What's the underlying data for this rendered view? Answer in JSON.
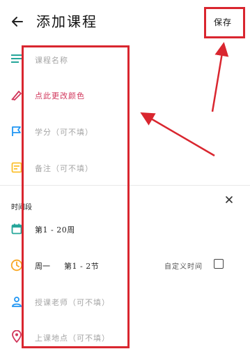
{
  "header": {
    "title": "添加课程",
    "save_label": "保存"
  },
  "form": {
    "course_name_placeholder": "课程名称",
    "color_label": "点此更改颜色",
    "credit_placeholder": "学分（可不填）",
    "note_placeholder": "备注（可不填）"
  },
  "time_section": {
    "label": "时间段",
    "weeks": "第1 - 20周",
    "day": "周一",
    "periods": "第1 - 2节",
    "custom_time_label": "自定义时间",
    "custom_time_checked": false,
    "teacher_placeholder": "授课老师（可不填）",
    "location_placeholder": "上课地点（可不填）"
  },
  "colors": {
    "accent_text": "#d1365b",
    "annotation_red": "#d9262f",
    "teal_icon": "#26a69a",
    "blue_icon": "#2196f3",
    "yellow_icon": "#fbc02d",
    "orange_icon": "#f9a825",
    "purple_icon": "#7e57c2"
  }
}
